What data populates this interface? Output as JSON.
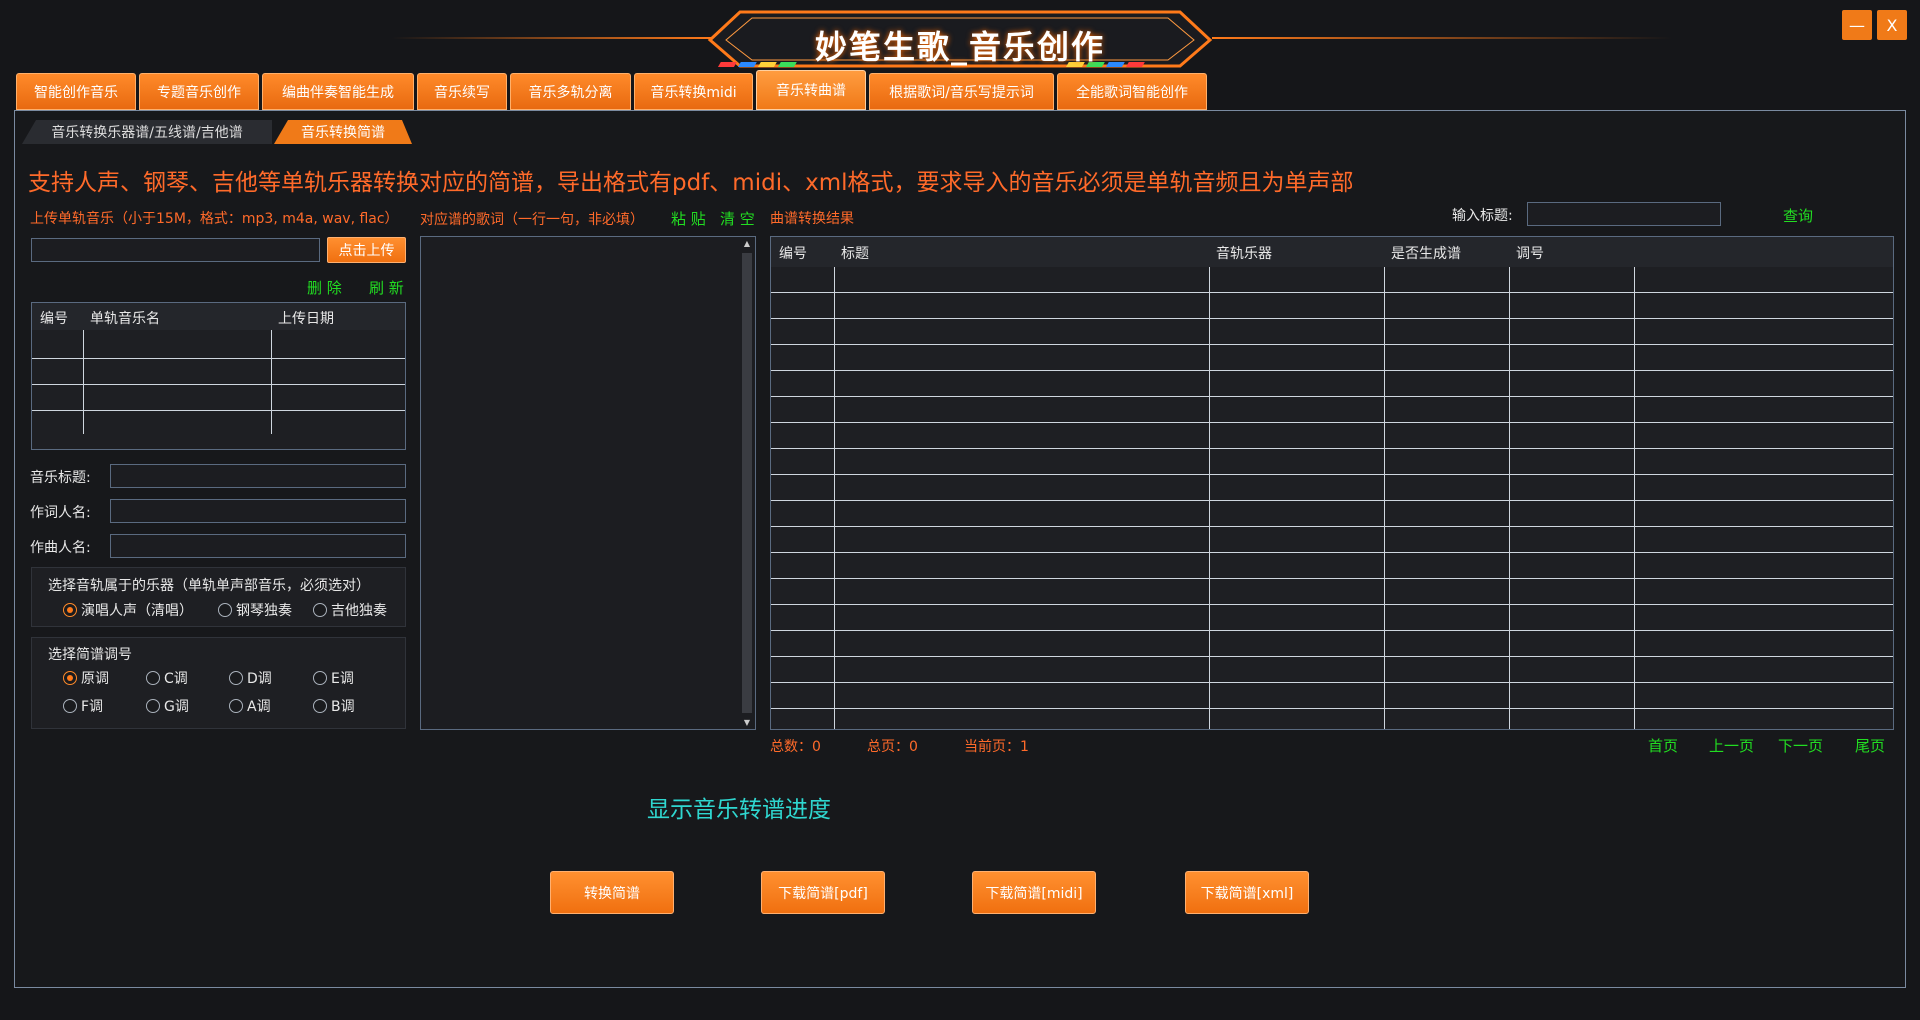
{
  "window": {
    "title": "妙笔生歌_音乐创作",
    "minimize_label": "—",
    "close_label": "X"
  },
  "main_tabs": [
    {
      "label": "智能创作音乐"
    },
    {
      "label": "专题音乐创作"
    },
    {
      "label": "编曲伴奏智能生成"
    },
    {
      "label": "音乐续写"
    },
    {
      "label": "音乐多轨分离"
    },
    {
      "label": "音乐转换midi"
    },
    {
      "label": "音乐转曲谱",
      "active": true
    },
    {
      "label": "根据歌词/音乐写提示词"
    },
    {
      "label": "全能歌词智能创作"
    }
  ],
  "sub_tabs": [
    {
      "label": "音乐转换乐器谱/五线谱/吉他谱"
    },
    {
      "label": "音乐转换简谱",
      "active": true
    }
  ],
  "headline": "支持人声、钢琴、吉他等单轨乐器转换对应的简谱，导出格式有pdf、midi、xml格式，要求导入的音乐必须是单轨音频且为单声部",
  "upload": {
    "label": "上传单轨音乐（小于15M，格式：mp3, m4a, wav, flac）",
    "input_value": "",
    "button": "点击上传",
    "delete": "删 除",
    "refresh": "刷 新"
  },
  "upload_table": {
    "columns": [
      "编号",
      "单轨音乐名",
      "上传日期"
    ],
    "rows": [
      [
        "",
        "",
        ""
      ],
      [
        "",
        "",
        ""
      ],
      [
        "",
        "",
        ""
      ],
      [
        "",
        "",
        ""
      ]
    ]
  },
  "form": {
    "music_title_label": "音乐标题:",
    "music_title_value": "",
    "lyricist_label": "作词人名:",
    "lyricist_value": "",
    "composer_label": "作曲人名:",
    "composer_value": ""
  },
  "instrument_group": {
    "title": "选择音轨属于的乐器（单轨单声部音乐，必须选对）",
    "options": [
      {
        "label": "演唱人声（清唱）",
        "checked": true
      },
      {
        "label": "钢琴独奏",
        "checked": false
      },
      {
        "label": "吉他独奏",
        "checked": false
      }
    ]
  },
  "key_group": {
    "title": "选择简谱调号",
    "options": [
      {
        "label": "原调",
        "checked": true
      },
      {
        "label": "C调",
        "checked": false
      },
      {
        "label": "D调",
        "checked": false
      },
      {
        "label": "E调",
        "checked": false
      },
      {
        "label": "F调",
        "checked": false
      },
      {
        "label": "G调",
        "checked": false
      },
      {
        "label": "A调",
        "checked": false
      },
      {
        "label": "B调",
        "checked": false
      }
    ]
  },
  "lyrics": {
    "label": "对应谱的歌词（一行一句，非必填）",
    "paste": "粘 贴",
    "clear": "清 空",
    "value": ""
  },
  "results": {
    "label": "曲谱转换结果",
    "search_label": "输入标题:",
    "search_value": "",
    "query": "查询",
    "columns": [
      "编号",
      "标题",
      "音轨乐器",
      "是否生成谱",
      "调号"
    ],
    "row_count": 17
  },
  "pagination": {
    "total": "总数：0",
    "pages": "总页：0",
    "current": "当前页：1",
    "first": "首页",
    "prev": "上一页",
    "next": "下一页",
    "last": "尾页"
  },
  "progress_text": "显示音乐转谱进度",
  "actions": [
    {
      "label": "转换简谱"
    },
    {
      "label": "下载简谱[pdf]"
    },
    {
      "label": "下载简谱[midi]"
    },
    {
      "label": "下载简谱[xml]"
    }
  ],
  "colors": {
    "accent": "#f07a18",
    "headline": "#ff6a2a",
    "link": "#22dd22",
    "progress": "#2fd7d0",
    "background": "#151619"
  }
}
